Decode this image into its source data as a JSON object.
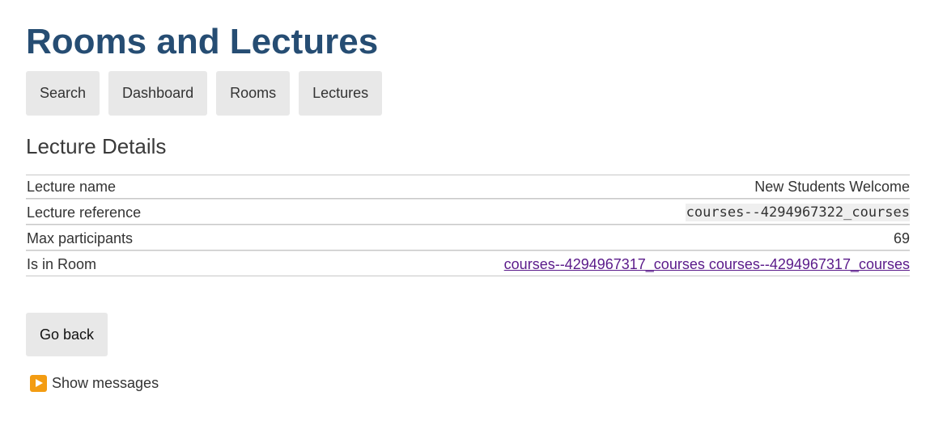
{
  "page_title": "Rooms and Lectures",
  "nav": {
    "items": [
      {
        "label": "Search"
      },
      {
        "label": "Dashboard"
      },
      {
        "label": "Rooms"
      },
      {
        "label": "Lectures"
      }
    ]
  },
  "section_title": "Lecture Details",
  "details": {
    "rows": [
      {
        "label": "Lecture name",
        "value": "New Students Welcome"
      },
      {
        "label": "Lecture reference",
        "value": "courses--4294967322_courses"
      },
      {
        "label": "Max participants",
        "value": "69"
      },
      {
        "label": "Is in Room",
        "value": "courses--4294967317_courses courses--4294967317_courses"
      }
    ]
  },
  "back_button": {
    "label": "Go back"
  },
  "messages_toggle": {
    "label": "Show messages",
    "icon": "play-button-icon"
  },
  "colors": {
    "title": "#264d73",
    "button_bg": "#e8e8e8",
    "link": "#5a1a8a",
    "icon_bg": "#f39c12"
  }
}
